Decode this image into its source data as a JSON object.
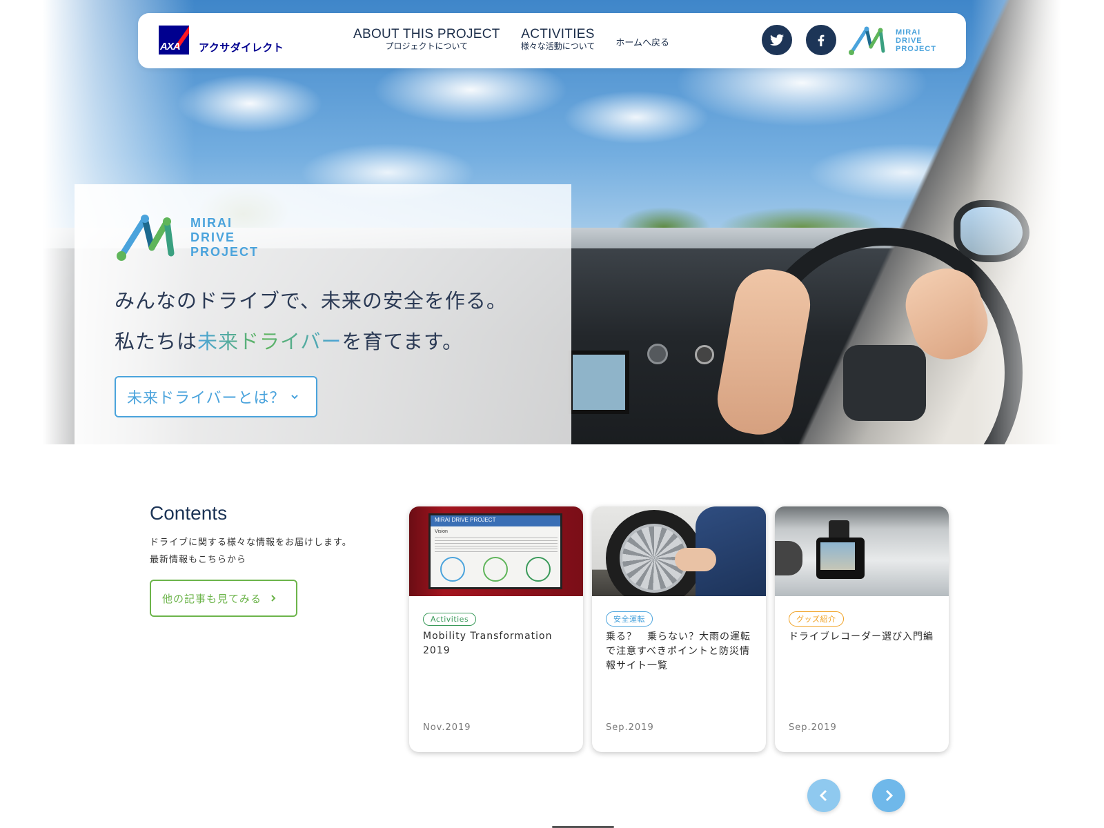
{
  "header": {
    "brand_name": "アクサダイレクト",
    "brand_logo_text": "AXA",
    "nav": [
      {
        "main": "ABOUT THIS PROJECT",
        "sub": "プロジェクトについて"
      },
      {
        "main": "ACTIVITIES",
        "sub": "様々な活動について"
      }
    ],
    "home_link": "ホームへ戻る",
    "social": [
      {
        "name": "twitter-icon"
      },
      {
        "name": "facebook-icon"
      }
    ],
    "project_logo_lines": [
      "MIRAI",
      "DRIVE",
      "PROJECT"
    ]
  },
  "hero": {
    "logo_lines": [
      "MIRAI",
      "DRIVE",
      "PROJECT"
    ],
    "line1": "みんなのドライブで、未来の安全を作る。",
    "line2_pre": "私たちは",
    "line2_highlight": "未来ドライバー",
    "line2_post": "を育てます。",
    "button_label": "未来ドライバーとは？",
    "button_icon": "chevron-down-icon"
  },
  "contents": {
    "title": "Contents",
    "desc_line1": "ドライブに関する様々な情報をお届けします。",
    "desc_line2": "最新情報もこちらから",
    "button_label": "他の記事も見てみる",
    "button_icon": "chevron-right-icon"
  },
  "cards": [
    {
      "tag": "Activities",
      "tag_color": "#3a9a5a",
      "title": "Mobility Transformation　2019",
      "date": "Nov.2019"
    },
    {
      "tag": "安全運転",
      "tag_color": "#4aa3dc",
      "title": "乗る？　乗らない？大雨の運転で注意すべきポイントと防災情報サイト一覧",
      "date": "Sep.2019"
    },
    {
      "tag": "グッズ紹介",
      "tag_color": "#f0a020",
      "title": "ドライブレコーダー選び入門編",
      "date": "Sep.2019"
    }
  ],
  "card1_image": {
    "header": "MIRAI DRIVE PROJECT",
    "subheading": "Vision"
  },
  "carousel": {
    "prev_icon": "chevron-left-icon",
    "next_icon": "chevron-right-icon"
  },
  "colors": {
    "accent_blue": "#4aa3dc",
    "accent_green": "#6cb44a",
    "navy": "#1d3557",
    "axa_blue": "#00008f",
    "axa_red": "#ff1721"
  }
}
